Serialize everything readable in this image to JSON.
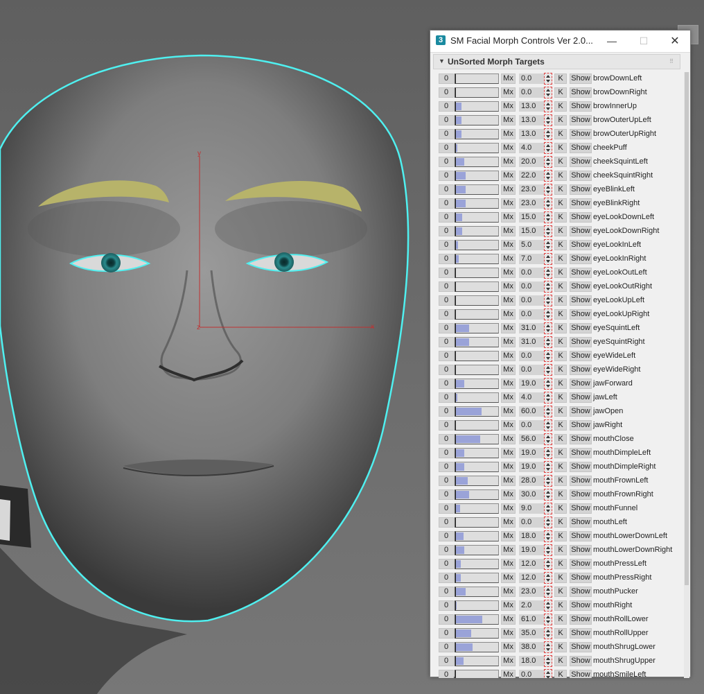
{
  "window": {
    "title": "SM Facial Morph Controls Ver 2.0...",
    "app_icon": "3",
    "minimize_glyph": "—",
    "maximize_glyph": "☐",
    "close_glyph": "✕"
  },
  "rollout": {
    "title": "UnSorted Morph Targets",
    "arrow": "▼",
    "grip": "⠿"
  },
  "buttons": {
    "zero": "0",
    "mx": "Mx",
    "k": "K",
    "show": "Show"
  },
  "viewport": {
    "axis_labels": {
      "y": "y",
      "x": "x",
      "z": "z"
    },
    "colors": {
      "selection": "#4ff0f0",
      "eyebrow": "#b7b36a",
      "iris": "#2a8a8c",
      "axis": "#c03030"
    }
  },
  "morphs": [
    {
      "name": "browDownLeft",
      "value": "0.0",
      "pct": 0
    },
    {
      "name": "browDownRight",
      "value": "0.0",
      "pct": 0
    },
    {
      "name": "browInnerUp",
      "value": "13.0",
      "pct": 13
    },
    {
      "name": "browOuterUpLeft",
      "value": "13.0",
      "pct": 13
    },
    {
      "name": "browOuterUpRight",
      "value": "13.0",
      "pct": 13
    },
    {
      "name": "cheekPuff",
      "value": "4.0",
      "pct": 4
    },
    {
      "name": "cheekSquintLeft",
      "value": "20.0",
      "pct": 20
    },
    {
      "name": "cheekSquintRight",
      "value": "22.0",
      "pct": 22
    },
    {
      "name": "eyeBlinkLeft",
      "value": "23.0",
      "pct": 23
    },
    {
      "name": "eyeBlinkRight",
      "value": "23.0",
      "pct": 23
    },
    {
      "name": "eyeLookDownLeft",
      "value": "15.0",
      "pct": 15
    },
    {
      "name": "eyeLookDownRight",
      "value": "15.0",
      "pct": 15
    },
    {
      "name": "eyeLookInLeft",
      "value": "5.0",
      "pct": 5
    },
    {
      "name": "eyeLookInRight",
      "value": "7.0",
      "pct": 7
    },
    {
      "name": "eyeLookOutLeft",
      "value": "0.0",
      "pct": 0
    },
    {
      "name": "eyeLookOutRight",
      "value": "0.0",
      "pct": 0
    },
    {
      "name": "eyeLookUpLeft",
      "value": "0.0",
      "pct": 0
    },
    {
      "name": "eyeLookUpRight",
      "value": "0.0",
      "pct": 0
    },
    {
      "name": "eyeSquintLeft",
      "value": "31.0",
      "pct": 31
    },
    {
      "name": "eyeSquintRight",
      "value": "31.0",
      "pct": 31
    },
    {
      "name": "eyeWideLeft",
      "value": "0.0",
      "pct": 0
    },
    {
      "name": "eyeWideRight",
      "value": "0.0",
      "pct": 0
    },
    {
      "name": "jawForward",
      "value": "19.0",
      "pct": 19
    },
    {
      "name": "jawLeft",
      "value": "4.0",
      "pct": 4
    },
    {
      "name": "jawOpen",
      "value": "60.0",
      "pct": 60
    },
    {
      "name": "jawRight",
      "value": "0.0",
      "pct": 0
    },
    {
      "name": "mouthClose",
      "value": "56.0",
      "pct": 56
    },
    {
      "name": "mouthDimpleLeft",
      "value": "19.0",
      "pct": 19
    },
    {
      "name": "mouthDimpleRight",
      "value": "19.0",
      "pct": 19
    },
    {
      "name": "mouthFrownLeft",
      "value": "28.0",
      "pct": 28
    },
    {
      "name": "mouthFrownRight",
      "value": "30.0",
      "pct": 30
    },
    {
      "name": "mouthFunnel",
      "value": "9.0",
      "pct": 9
    },
    {
      "name": "mouthLeft",
      "value": "0.0",
      "pct": 0
    },
    {
      "name": "mouthLowerDownLeft",
      "value": "18.0",
      "pct": 18
    },
    {
      "name": "mouthLowerDownRight",
      "value": "19.0",
      "pct": 19
    },
    {
      "name": "mouthPressLeft",
      "value": "12.0",
      "pct": 12
    },
    {
      "name": "mouthPressRight",
      "value": "12.0",
      "pct": 12
    },
    {
      "name": "mouthPucker",
      "value": "23.0",
      "pct": 23
    },
    {
      "name": "mouthRight",
      "value": "2.0",
      "pct": 2
    },
    {
      "name": "mouthRollLower",
      "value": "61.0",
      "pct": 61
    },
    {
      "name": "mouthRollUpper",
      "value": "35.0",
      "pct": 35
    },
    {
      "name": "mouthShrugLower",
      "value": "38.0",
      "pct": 38
    },
    {
      "name": "mouthShrugUpper",
      "value": "18.0",
      "pct": 18
    },
    {
      "name": "mouthSmileLeft",
      "value": "0.0",
      "pct": 0
    }
  ]
}
